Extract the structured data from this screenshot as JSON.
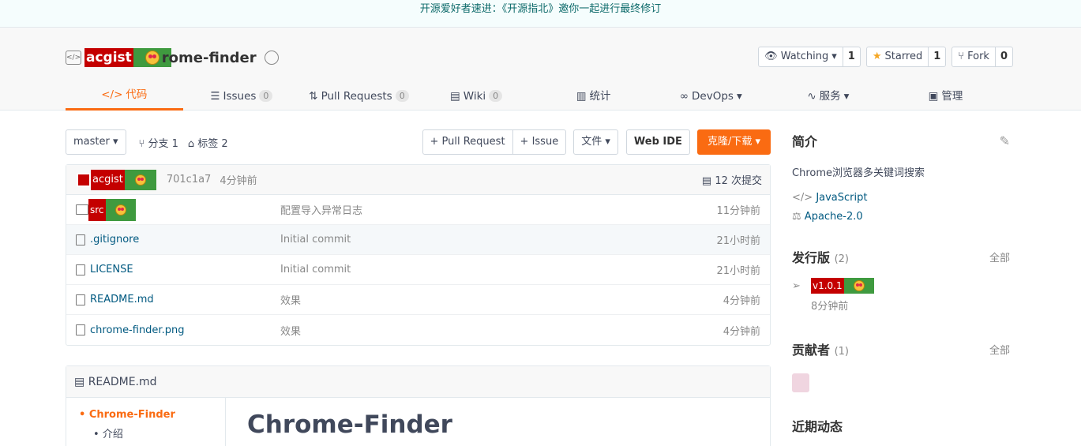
{
  "banner": "开源爱好者速进：《开源指北》邀你一起进行最终修订",
  "repo": {
    "owner_tag": "acgist",
    "name_visible": "rome-finder"
  },
  "actions": {
    "watch_label": "Watching",
    "watch_count": "1",
    "star_label": "Starred",
    "star_count": "1",
    "fork_label": "Fork",
    "fork_count": "0"
  },
  "tabs": [
    {
      "label": "代码"
    },
    {
      "label": "Issues",
      "count": "0"
    },
    {
      "label": "Pull Requests",
      "count": "0"
    },
    {
      "label": "Wiki",
      "count": "0"
    },
    {
      "label": "统计"
    },
    {
      "label": "DevOps"
    },
    {
      "label": "服务"
    },
    {
      "label": "管理"
    }
  ],
  "toolbar": {
    "branch": "master",
    "branches": "分支 1",
    "tags": "标签 2",
    "pull_request": "+ Pull Request",
    "issue": "+ Issue",
    "file": "文件",
    "web_ide": "Web IDE",
    "clone": "克隆/下载"
  },
  "commit": {
    "author": "acgist",
    "hash": "701c1a7",
    "time": "4分钟前",
    "count": "12 次提交"
  },
  "files": [
    {
      "name": "src",
      "msg": "配置导入异常日志",
      "time": "11分钟前"
    },
    {
      "name": ".gitignore",
      "msg": "Initial commit",
      "time": "21小时前"
    },
    {
      "name": "LICENSE",
      "msg": "Initial commit",
      "time": "21小时前"
    },
    {
      "name": "README.md",
      "msg": "效果",
      "time": "4分钟前"
    },
    {
      "name": "chrome-finder.png",
      "msg": "效果",
      "time": "4分钟前"
    }
  ],
  "readme": {
    "filename": "README.md",
    "toc_1": "Chrome-Finder",
    "toc_2": "介绍",
    "heading": "Chrome-Finder"
  },
  "sidebar": {
    "intro_title": "简介",
    "description": "Chrome浏览器多关键词搜索",
    "language": "JavaScript",
    "license": "Apache-2.0",
    "releases_title": "发行版",
    "releases_count": "(2)",
    "all_label": "全部",
    "release_tag": "v1.0.1",
    "release_time": "8分钟前",
    "contributors_title": "贡献者",
    "contributors_count": "(1)",
    "activity_title": "近期动态"
  }
}
